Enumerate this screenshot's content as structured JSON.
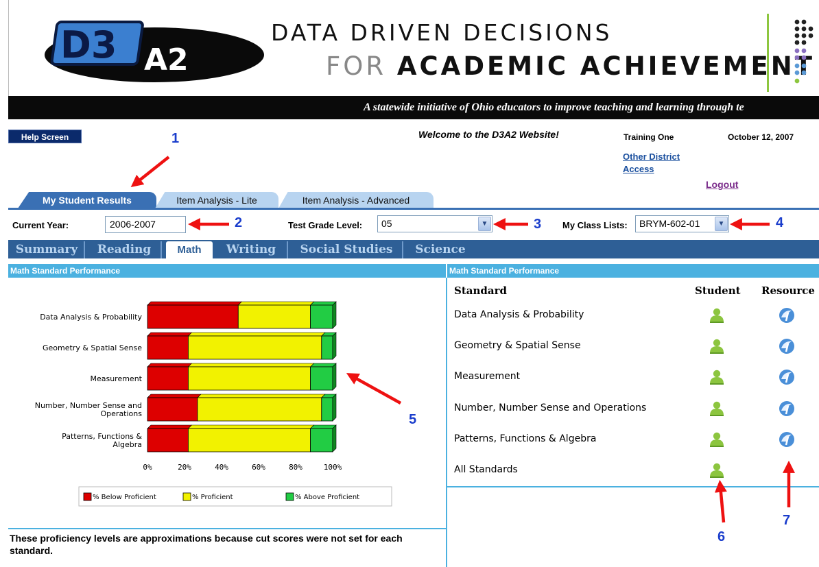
{
  "header": {
    "logo_main": "D3",
    "logo_sub": "A2",
    "title_line1": "DATA DRIVEN DECISIONS",
    "title_line2_light": "FOR",
    "title_line2_bold": "ACADEMIC ACHIEVEMENT",
    "tagline": "A statewide initiative of Ohio educators to improve teaching and learning through te"
  },
  "topbar": {
    "help_label": "Help Screen",
    "welcome": "Welcome to the D3A2 Website!",
    "user_name": "Training One",
    "date": "October 12, 2007",
    "other_access": "Other District Access",
    "logout": "Logout"
  },
  "primary_tabs": [
    {
      "label": "My Student Results",
      "active": true
    },
    {
      "label": "Item Analysis - Lite",
      "active": false
    },
    {
      "label": "Item Analysis - Advanced",
      "active": false
    }
  ],
  "filters": {
    "year_label": "Current Year:",
    "year_value": "2006-2007",
    "grade_label": "Test Grade Level:",
    "grade_value": "05",
    "class_label": "My Class Lists:",
    "class_value": "BRYM-602-01"
  },
  "subject_tabs": [
    {
      "label": "Summary",
      "active": false
    },
    {
      "label": "Reading",
      "active": false
    },
    {
      "label": "Math",
      "active": true
    },
    {
      "label": "Writing",
      "active": false
    },
    {
      "label": "Social Studies",
      "active": false
    },
    {
      "label": "Science",
      "active": false
    }
  ],
  "left_panel": {
    "heading": "Math Standard Performance",
    "note": "These proficiency levels are approximations because cut scores were not set for each standard."
  },
  "right_panel": {
    "heading": "Math Standard Performance",
    "col_standard": "Standard",
    "col_student": "Student",
    "col_resource": "Resource",
    "rows": [
      {
        "label": "Data Analysis & Probability",
        "has_resource": true
      },
      {
        "label": "Geometry & Spatial Sense",
        "has_resource": true
      },
      {
        "label": "Measurement",
        "has_resource": true
      },
      {
        "label": "Number, Number Sense and Operations",
        "has_resource": true
      },
      {
        "label": "Patterns, Functions & Algebra",
        "has_resource": true
      },
      {
        "label": "All Standards",
        "has_resource": false
      }
    ]
  },
  "annotations": [
    "1",
    "2",
    "3",
    "4",
    "5",
    "6",
    "7"
  ],
  "colors": {
    "below": "#dd0000",
    "proficient": "#f2f200",
    "above": "#22cc44",
    "tab_blue": "#3a70b4",
    "panel_head": "#4bb1e0",
    "arrow_red": "#ee1111"
  },
  "chart_data": {
    "type": "bar",
    "orientation": "horizontal",
    "stacked": true,
    "categories": [
      [
        "Data Analysis & Probability"
      ],
      [
        "Geometry & Spatial Sense"
      ],
      [
        "Measurement"
      ],
      [
        "Number, Number Sense and",
        "Operations"
      ],
      [
        "Patterns, Functions &",
        "Algebra"
      ]
    ],
    "series": [
      {
        "name": "% Below Proficient",
        "values": [
          49,
          22,
          22,
          27,
          22
        ]
      },
      {
        "name": "% Proficient",
        "values": [
          39,
          72,
          66,
          67,
          66
        ]
      },
      {
        "name": "% Above Proficient",
        "values": [
          12,
          6,
          12,
          6,
          12
        ]
      }
    ],
    "xlim": [
      0,
      100
    ],
    "xticks": [
      "0%",
      "20%",
      "40%",
      "60%",
      "80%",
      "100%"
    ],
    "legend": "bottom"
  }
}
